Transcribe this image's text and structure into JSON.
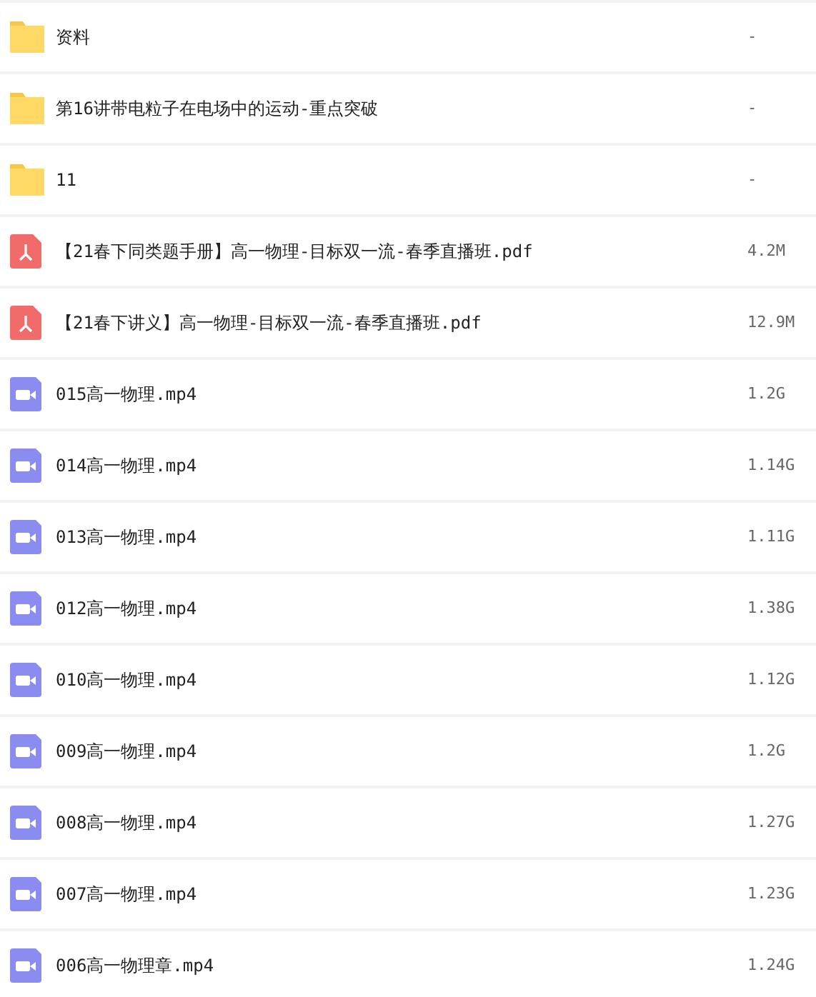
{
  "files": [
    {
      "kind": "folder",
      "name": "资料",
      "size": "-"
    },
    {
      "kind": "folder",
      "name": "第16讲带电粒子在电场中的运动-重点突破",
      "size": "-"
    },
    {
      "kind": "folder",
      "name": "11",
      "size": "-"
    },
    {
      "kind": "pdf",
      "name": "【21春下同类题手册】高一物理-目标双一流-春季直播班.pdf",
      "size": "4.2M"
    },
    {
      "kind": "pdf",
      "name": "【21春下讲义】高一物理-目标双一流-春季直播班.pdf",
      "size": "12.9M"
    },
    {
      "kind": "video",
      "name": "015高一物理.mp4",
      "size": "1.2G"
    },
    {
      "kind": "video",
      "name": "014高一物理.mp4",
      "size": "1.14G"
    },
    {
      "kind": "video",
      "name": "013高一物理.mp4",
      "size": "1.11G"
    },
    {
      "kind": "video",
      "name": "012高一物理.mp4",
      "size": "1.38G"
    },
    {
      "kind": "video",
      "name": "010高一物理.mp4",
      "size": "1.12G"
    },
    {
      "kind": "video",
      "name": "009高一物理.mp4",
      "size": "1.2G"
    },
    {
      "kind": "video",
      "name": "008高一物理.mp4",
      "size": "1.27G"
    },
    {
      "kind": "video",
      "name": "007高一物理.mp4",
      "size": "1.23G"
    },
    {
      "kind": "video",
      "name": "006高一物理章.mp4",
      "size": "1.24G"
    }
  ]
}
